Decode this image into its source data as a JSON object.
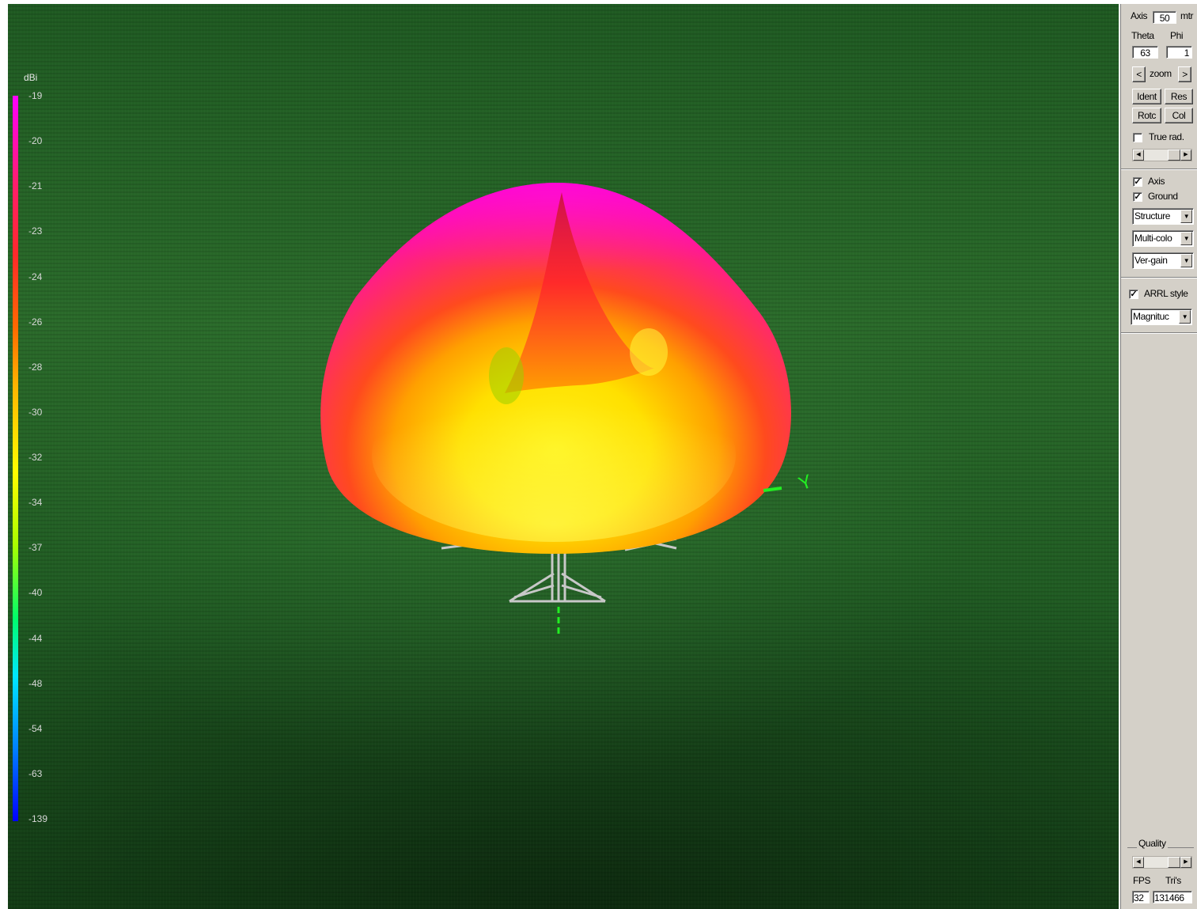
{
  "legend": {
    "unit": "dBi",
    "ticks": [
      "-19",
      "-20",
      "-21",
      "-23",
      "-24",
      "-26",
      "-28",
      "-30",
      "-32",
      "-34",
      "-37",
      "-40",
      "-44",
      "-48",
      "-54",
      "-63",
      "-139"
    ]
  },
  "scene": {
    "axis_y_label": "Y"
  },
  "panel": {
    "axis_label": "Axis",
    "axis_value": "50",
    "axis_unit": "mtr",
    "theta_label": "Theta",
    "phi_label": "Phi",
    "theta_value": "63",
    "phi_value": "1",
    "zoom_left": "<",
    "zoom_label": "zoom",
    "zoom_right": ">",
    "ident_label": "Ident",
    "res_label": "Res",
    "rotate_label": "Rotc",
    "col_label": "Col",
    "true_rad_label": "True rad.",
    "true_rad_checked": false,
    "axis_check_label": "Axis",
    "axis_checked": true,
    "ground_label": "Ground",
    "ground_checked": true,
    "structure_select": "Structure",
    "color_select": "Multi-colo",
    "gain_select": "Ver-gain",
    "arrl_label": "ARRL style",
    "arrl_checked": true,
    "magnitude_select": "Magnituc",
    "quality_label": "Quality",
    "fps_label": "FPS",
    "tris_label": "Tri's",
    "fps_value": "32",
    "tris_value": "131466"
  }
}
